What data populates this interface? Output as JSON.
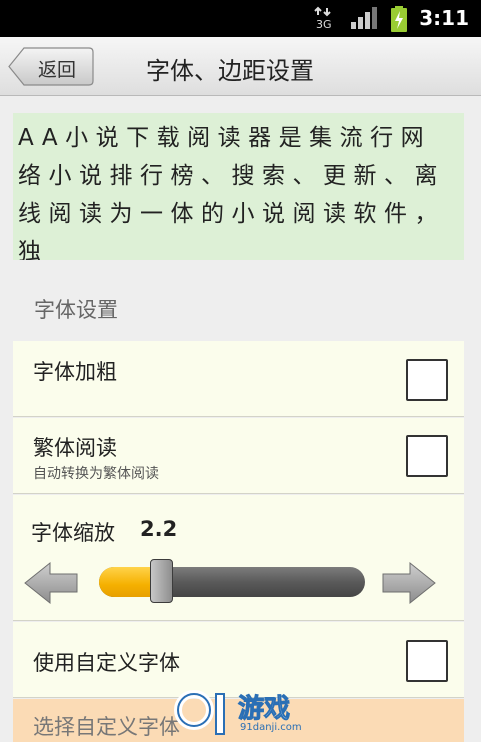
{
  "status_bar": {
    "network": "3G",
    "time": "3:11"
  },
  "header": {
    "back_label": "返回",
    "title": "字体、边距设置"
  },
  "preview_text": "AA小说下载阅读器是集流行网络小说排行榜、搜索、更新、离线阅读为一体的小说阅读软件，独",
  "font_section": {
    "header": "字体设置",
    "bold": {
      "label": "字体加粗",
      "checked": false
    },
    "traditional": {
      "label": "繁体阅读",
      "summary": "自动转换为繁体阅读",
      "checked": false
    },
    "scale": {
      "label": "字体缩放",
      "value": "2.2",
      "position": 0.21
    },
    "custom_font": {
      "label": "使用自定义字体",
      "checked": false
    },
    "choose_font": {
      "label": "选择自定义字体",
      "enabled": false
    }
  },
  "watermark": {
    "brand": "游戏",
    "site": "91danji.com"
  },
  "colors": {
    "preview_bg": "#ddf0d6",
    "row_bg": "#fbfdec",
    "slider_fill": "#f5b000",
    "disabled_row_bg": "#fbdbb5"
  }
}
